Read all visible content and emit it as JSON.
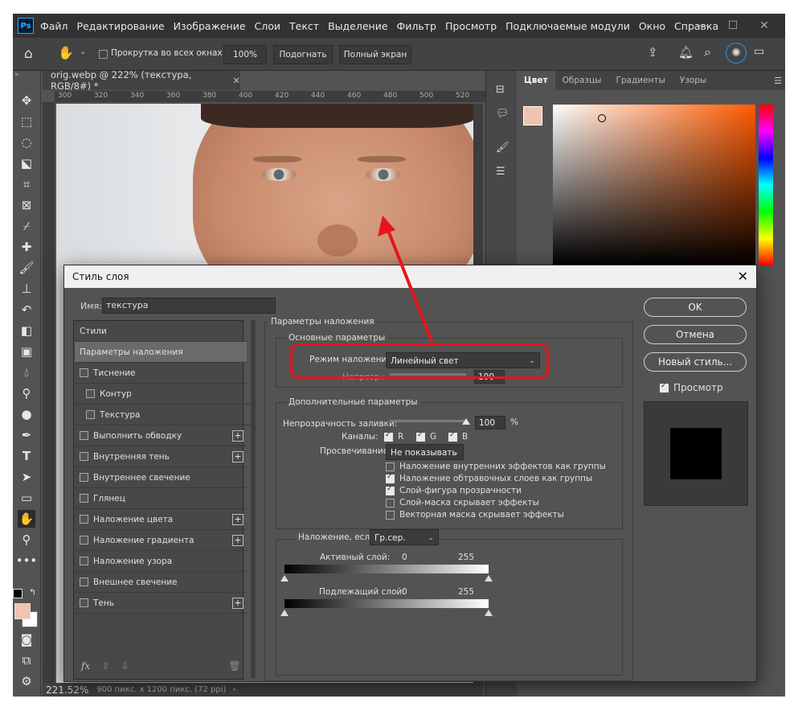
{
  "menu": [
    "Файл",
    "Редактирование",
    "Изображение",
    "Слои",
    "Текст",
    "Выделение",
    "Фильтр",
    "Просмотр",
    "Подключаемые модули",
    "Окно",
    "Справка"
  ],
  "app_logo": "Ps",
  "options": {
    "scroll_all": "Прокрутка во всех окнах",
    "zoom_btn": "100%",
    "fit_btn": "Подогнать",
    "fullscreen_btn": "Полный экран"
  },
  "document": {
    "tab_title": "orig.webp @ 222% (текстура, RGB/8#) *",
    "ruler_ticks": [
      "300",
      "320",
      "340",
      "360",
      "380",
      "400",
      "420",
      "440",
      "460",
      "480",
      "500",
      "520"
    ],
    "zoom": "221.52%",
    "size_info": "900 пикс. x 1200 пикс. (72 ppi)"
  },
  "color_panel": {
    "tabs": [
      "Цвет",
      "Образцы",
      "Градиенты",
      "Узоры"
    ],
    "foreground": "#f1c2ad",
    "background": "#ffffff"
  },
  "dialog": {
    "title": "Стиль слоя",
    "name_label": "Имя:",
    "name_value": "текстура",
    "styles": [
      {
        "label": "Стили",
        "checkbox": false,
        "plus": false,
        "selected": false,
        "indent": false
      },
      {
        "label": "Параметры наложения",
        "checkbox": false,
        "plus": false,
        "selected": true,
        "indent": false
      },
      {
        "label": "Тиснение",
        "checkbox": true,
        "plus": false,
        "selected": false,
        "indent": false
      },
      {
        "label": "Контур",
        "checkbox": true,
        "plus": false,
        "selected": false,
        "indent": true
      },
      {
        "label": "Текстура",
        "checkbox": true,
        "plus": false,
        "selected": false,
        "indent": true
      },
      {
        "label": "Выполнить обводку",
        "checkbox": true,
        "plus": true,
        "selected": false,
        "indent": false
      },
      {
        "label": "Внутренняя тень",
        "checkbox": true,
        "plus": true,
        "selected": false,
        "indent": false
      },
      {
        "label": "Внутреннее свечение",
        "checkbox": true,
        "plus": false,
        "selected": false,
        "indent": false
      },
      {
        "label": "Глянец",
        "checkbox": true,
        "plus": false,
        "selected": false,
        "indent": false
      },
      {
        "label": "Наложение цвета",
        "checkbox": true,
        "plus": true,
        "selected": false,
        "indent": false
      },
      {
        "label": "Наложение градиента",
        "checkbox": true,
        "plus": true,
        "selected": false,
        "indent": false
      },
      {
        "label": "Наложение узора",
        "checkbox": true,
        "plus": false,
        "selected": false,
        "indent": false
      },
      {
        "label": "Внешнее свечение",
        "checkbox": true,
        "plus": false,
        "selected": false,
        "indent": false
      },
      {
        "label": "Тень",
        "checkbox": true,
        "plus": true,
        "selected": false,
        "indent": false
      }
    ],
    "fx_label": "fx",
    "blend": {
      "section_title": "Параметры наложения",
      "basic_title": "Основные параметры",
      "mode_label": "Режим наложения:",
      "mode_value": "Линейный свет",
      "opacity_label": "Непрозр.:",
      "opacity_value": "100",
      "advanced_title": "Дополнительные параметры",
      "fill_opacity_label": "Непрозрачность заливки:",
      "fill_opacity_value": "100",
      "fill_opacity_fraction": 1.0,
      "percent": "%",
      "channels_label": "Каналы:",
      "channels": [
        {
          "label": "R",
          "on": true
        },
        {
          "label": "G",
          "on": true
        },
        {
          "label": "B",
          "on": true
        }
      ],
      "knockout_label": "Просвечивание:",
      "knockout_value": "Не показывать",
      "options": [
        {
          "label": "Наложение внутренних эффектов как группы",
          "on": false
        },
        {
          "label": "Наложение обтравочных слоев как группы",
          "on": true
        },
        {
          "label": "Слой-фигура прозрачности",
          "on": true
        },
        {
          "label": "Слой-маска скрывает эффекты",
          "on": false
        },
        {
          "label": "Векторная маска скрывает эффекты",
          "on": false
        }
      ],
      "blendif_label": "Наложение, если:",
      "blendif_value": "Гр.сер.",
      "this_layer_label": "Активный слой:",
      "this_layer_min": "0",
      "this_layer_max": "255",
      "underlying_label": "Подлежащий слой:",
      "underlying_min": "0",
      "underlying_max": "255"
    },
    "buttons": {
      "ok": "OK",
      "cancel": "Отмена",
      "new_style": "Новый стиль...",
      "preview_label": "Просмотр",
      "preview_on": true
    }
  },
  "annotation_color": "#e3171b"
}
